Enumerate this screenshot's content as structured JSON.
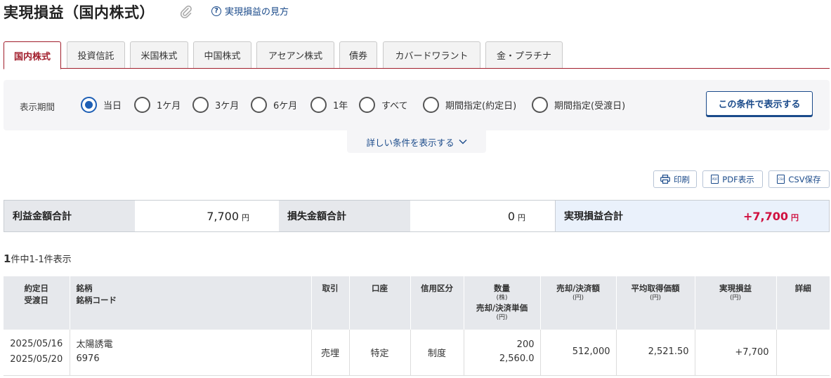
{
  "header": {
    "title": "実現損益（国内株式）",
    "help_link": "実現損益の見方"
  },
  "tabs": [
    {
      "label": "国内株式",
      "active": true
    },
    {
      "label": "投資信託"
    },
    {
      "label": "米国株式"
    },
    {
      "label": "中国株式"
    },
    {
      "label": "アセアン株式"
    },
    {
      "label": "債券"
    },
    {
      "label": "カバードワラント"
    },
    {
      "label": "金・プラチナ"
    }
  ],
  "filter": {
    "period_label": "表示期間",
    "options": [
      "当日",
      "1ケ月",
      "3ケ月",
      "6ケ月",
      "1年",
      "すべて",
      "期間指定(約定日)",
      "期間指定(受渡日)"
    ],
    "selected": "当日",
    "apply_button": "この条件で表示する",
    "more_conditions": "詳しい条件を表示する"
  },
  "actions": {
    "print": "印刷",
    "pdf": "PDF表示",
    "csv": "CSV保存"
  },
  "summary": {
    "profit_label": "利益金額合計",
    "profit_value": "7,700",
    "loss_label": "損失金額合計",
    "loss_value": "0",
    "total_label": "実現損益合計",
    "total_value": "+7,700",
    "yen": "円"
  },
  "count": {
    "total": "1",
    "text": "件中1-1件表示"
  },
  "table": {
    "headers": {
      "trade_date": "約定日",
      "settle_date": "受渡日",
      "stock": "銘柄",
      "stock_code": "銘柄コード",
      "trade": "取引",
      "account": "口座",
      "margin_type": "信用区分",
      "quantity": "数量",
      "quantity_unit": "(株)",
      "unit_price": "売却/決済単価",
      "unit_price_unit": "(円)",
      "amount": "売却/決済額",
      "amount_unit": "(円)",
      "avg_cost": "平均取得価額",
      "avg_cost_unit": "(円)",
      "realized": "実現損益",
      "realized_unit": "(円)",
      "detail": "詳細"
    },
    "rows": [
      {
        "trade_date": "2025/05/16",
        "settle_date": "2025/05/20",
        "stock_name": "太陽誘電",
        "stock_code": "6976",
        "trade": "売埋",
        "account": "特定",
        "margin_type": "制度",
        "quantity": "200",
        "unit_price": "2,560.0",
        "amount": "512,000",
        "avg_cost": "2,521.50",
        "realized": "+7,700"
      }
    ]
  },
  "colors": {
    "accent_red": "#a11d2b",
    "profit_red": "#d01140",
    "link_blue": "#1a4a8a",
    "radio_blue": "#1e5fb5"
  }
}
